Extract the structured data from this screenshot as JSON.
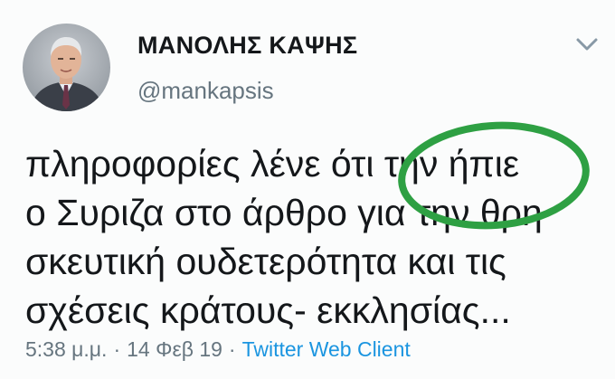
{
  "tweet": {
    "author": {
      "display_name": "ΜΑΝΟΛΗΣ ΚΑΨΗΣ",
      "handle": "@mankapsis",
      "avatar_icon": "profile-photo"
    },
    "menu_icon": "chevron-down-icon",
    "text_lines": [
      "πληροφορίες λένε ότι την ήπιε",
      "ο Συριζα στο άρθρο για την θρη",
      "σκευτική ουδετερότητα και τις",
      "σχέσεις κράτους- εκκλησίας..."
    ],
    "time": "5:38 μ.μ.",
    "separator": "·",
    "date": "14 Φεβ 19",
    "client": "Twitter Web Client",
    "colors": {
      "text": "#14171a",
      "muted": "#66757f",
      "link": "#1b95e0",
      "annotation_circle": "#2ea043"
    }
  }
}
